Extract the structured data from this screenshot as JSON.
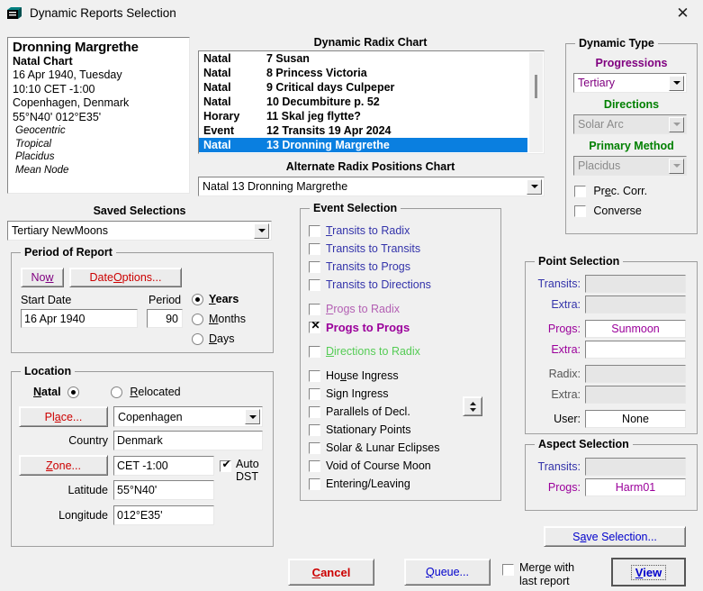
{
  "window": {
    "title": "Dynamic Reports Selection",
    "icon": "window-report-icon",
    "close_label": "✕"
  },
  "chart_info": {
    "name": "Dronning Margrethe",
    "type": "Natal Chart",
    "date": "16 Apr 1940, Tuesday",
    "time": "10:10  CET -1:00",
    "place": "Copenhagen, Denmark",
    "coords": "55°N40' 012°E35'",
    "system1": "Geocentric",
    "system2": "Tropical",
    "system3": "Placidus",
    "system4": "Mean Node"
  },
  "radix": {
    "title": "Dynamic Radix Chart",
    "rows": [
      {
        "kind": "Natal",
        "name": "7 Susan",
        "selected": false
      },
      {
        "kind": "Natal",
        "name": "8 Princess Victoria",
        "selected": false
      },
      {
        "kind": "Natal",
        "name": "9 Critical days Culpeper",
        "selected": false
      },
      {
        "kind": "Natal",
        "name": "10 Decumbiture p. 52",
        "selected": false
      },
      {
        "kind": "Horary",
        "name": "11 Skal jeg flytte?",
        "selected": false
      },
      {
        "kind": "Event",
        "name": "12 Transits 19 Apr 2024",
        "selected": false
      },
      {
        "kind": "Natal",
        "name": "13 Dronning Margrethe",
        "selected": true
      }
    ],
    "selection_color": "#0a7fe0"
  },
  "alternate": {
    "title": "Alternate Radix Positions Chart",
    "value": "Natal 13 Dronning Margrethe"
  },
  "dynamic_type": {
    "legend": "Dynamic Type",
    "progressions_label": "Progressions",
    "progressions_value": "Tertiary",
    "directions_label": "Directions",
    "directions_value": "Solar Arc",
    "primary_label": "Primary Method",
    "primary_value": "Placidus",
    "prec_corr": {
      "label_pre": "Pr",
      "label_key": "e",
      "label_post": "c. Corr.",
      "checked": false
    },
    "converse": {
      "label": "Converse",
      "checked": false
    },
    "progressions_color": "#800080",
    "directions_color": "#008000"
  },
  "saved_selections": {
    "title": "Saved Selections",
    "value": "Tertiary NewMoons"
  },
  "period": {
    "legend": "Period of Report",
    "now_label_pre": "No",
    "now_label_key": "w",
    "now_label_post": "",
    "date_options_pre": "Date ",
    "date_options_key": "O",
    "date_options_post": "ptions...",
    "start_date_label": "Start Date",
    "start_date_value": "16 Apr 1940",
    "period_label": "Period",
    "period_value": "90",
    "units": [
      {
        "pre": "",
        "key": "Y",
        "post": "ears",
        "selected": true
      },
      {
        "pre": "",
        "key": "M",
        "post": "onths",
        "selected": false
      },
      {
        "pre": "",
        "key": "D",
        "post": "ays",
        "selected": false
      }
    ]
  },
  "location": {
    "legend": "Location",
    "natal": {
      "pre": "",
      "key": "N",
      "post": "atal",
      "selected": true
    },
    "relocated": {
      "pre": "",
      "key": "R",
      "post": "elocated",
      "selected": false
    },
    "place_btn_pre": "Pl",
    "place_btn_key": "a",
    "place_btn_post": "ce...",
    "place_value": "Copenhagen",
    "country_label": "Country",
    "country_value": "Denmark",
    "zone_btn_pre": "",
    "zone_btn_key": "Z",
    "zone_btn_post": "one...",
    "zone_value": "CET -1:00",
    "auto_dst_line1": "Auto",
    "auto_dst_line2": "DST",
    "auto_dst_checked": true,
    "latitude_label": "Latitude",
    "latitude_value": "55°N40'",
    "longitude_label": "Longitude",
    "longitude_value": "012°E35'"
  },
  "event_selection": {
    "legend": "Event Selection",
    "items": [
      {
        "pre": "",
        "key": "T",
        "post": "ransits to Radix",
        "checked": false,
        "color": "#3333aa",
        "bold": false,
        "gap": 0
      },
      {
        "pre": "Transits to Transits",
        "key": "",
        "post": "",
        "checked": false,
        "color": "#3333aa",
        "bold": false,
        "gap": 0
      },
      {
        "pre": "Transits to Progs",
        "key": "",
        "post": "",
        "checked": false,
        "color": "#3333aa",
        "bold": false,
        "gap": 0
      },
      {
        "pre": "Transits to Directions",
        "key": "",
        "post": "",
        "checked": false,
        "color": "#3333aa",
        "bold": false,
        "gap": 0
      },
      {
        "pre": "",
        "key": "P",
        "post": "rogs to Radix",
        "checked": false,
        "color": "#b35fb3",
        "bold": false,
        "gap": 7
      },
      {
        "pre": "Progs to Progs",
        "key": "",
        "post": "",
        "checked": true,
        "color": "#9b009b",
        "bold": true,
        "gap": 0
      },
      {
        "pre": "",
        "key": "D",
        "post": "irections to Radix",
        "checked": false,
        "color": "#55cc55",
        "bold": false,
        "gap": 7
      },
      {
        "pre": "Ho",
        "key": "u",
        "post": "se Ingress",
        "checked": false,
        "color": "#000000",
        "bold": false,
        "gap": 7
      },
      {
        "pre": "Sign Ingress",
        "key": "",
        "post": "",
        "checked": false,
        "color": "#000000",
        "bold": false,
        "gap": 0
      },
      {
        "pre": "Parallels of Decl.",
        "key": "",
        "post": "",
        "checked": false,
        "color": "#000000",
        "bold": false,
        "gap": 0
      },
      {
        "pre": "Stationary Points",
        "key": "",
        "post": "",
        "checked": false,
        "color": "#000000",
        "bold": false,
        "gap": 0
      },
      {
        "pre": "Solar & Lunar Eclipses",
        "key": "",
        "post": "",
        "checked": false,
        "color": "#000000",
        "bold": false,
        "gap": 0
      },
      {
        "pre": "Void of Course Moon",
        "key": "",
        "post": "",
        "checked": false,
        "color": "#000000",
        "bold": false,
        "gap": 0
      },
      {
        "pre": "Entering/Leaving",
        "key": "",
        "post": "",
        "checked": false,
        "color": "#000000",
        "bold": false,
        "gap": 0
      }
    ],
    "spinner": "up-down-spinner"
  },
  "point_selection": {
    "legend": "Point Selection",
    "rows": [
      {
        "label": "Transits:",
        "value": "",
        "label_color": "#3333aa",
        "value_color": "#3333aa",
        "disabled": true
      },
      {
        "label": "Extra:",
        "value": "",
        "label_color": "#3333aa",
        "value_color": "#3333aa",
        "disabled": true
      },
      {
        "label": "Progs:",
        "value": "Sunmoon",
        "label_color": "#9b009b",
        "value_color": "#9b009b",
        "disabled": false
      },
      {
        "label": "Extra:",
        "value": "",
        "label_color": "#9b009b",
        "value_color": "#9b009b",
        "disabled": false
      },
      {
        "label": "Radix:",
        "value": "",
        "label_color": "#555555",
        "value_color": "#555555",
        "disabled": true
      },
      {
        "label": "Extra:",
        "value": "",
        "label_color": "#555555",
        "value_color": "#555555",
        "disabled": true
      },
      {
        "label": "User:",
        "value": "None",
        "label_color": "#000000",
        "value_color": "#000000",
        "disabled": false
      }
    ]
  },
  "aspect_selection": {
    "legend": "Aspect Selection",
    "rows": [
      {
        "label": "Transits:",
        "value": "",
        "label_color": "#3333aa",
        "value_color": "#3333aa",
        "disabled": true
      },
      {
        "label": "Progs:",
        "value": "Harm01",
        "label_color": "#9b009b",
        "value_color": "#9b009b",
        "disabled": false
      }
    ]
  },
  "footer": {
    "save_selection_pre": "S",
    "save_selection_key": "a",
    "save_selection_post": "ve Selection...",
    "cancel_pre": "",
    "cancel_key": "C",
    "cancel_post": "ancel",
    "queue_pre": "",
    "queue_key": "Q",
    "queue_post": "ueue...",
    "merge_line1": "Merge with",
    "merge_line2": "last report",
    "merge_checked": false,
    "view_pre": "",
    "view_key": "V",
    "view_post": "iew",
    "cancel_color": "#cc0000",
    "queue_color": "#0000cc",
    "view_color": "#0000cc",
    "save_color": "#0000cc"
  }
}
